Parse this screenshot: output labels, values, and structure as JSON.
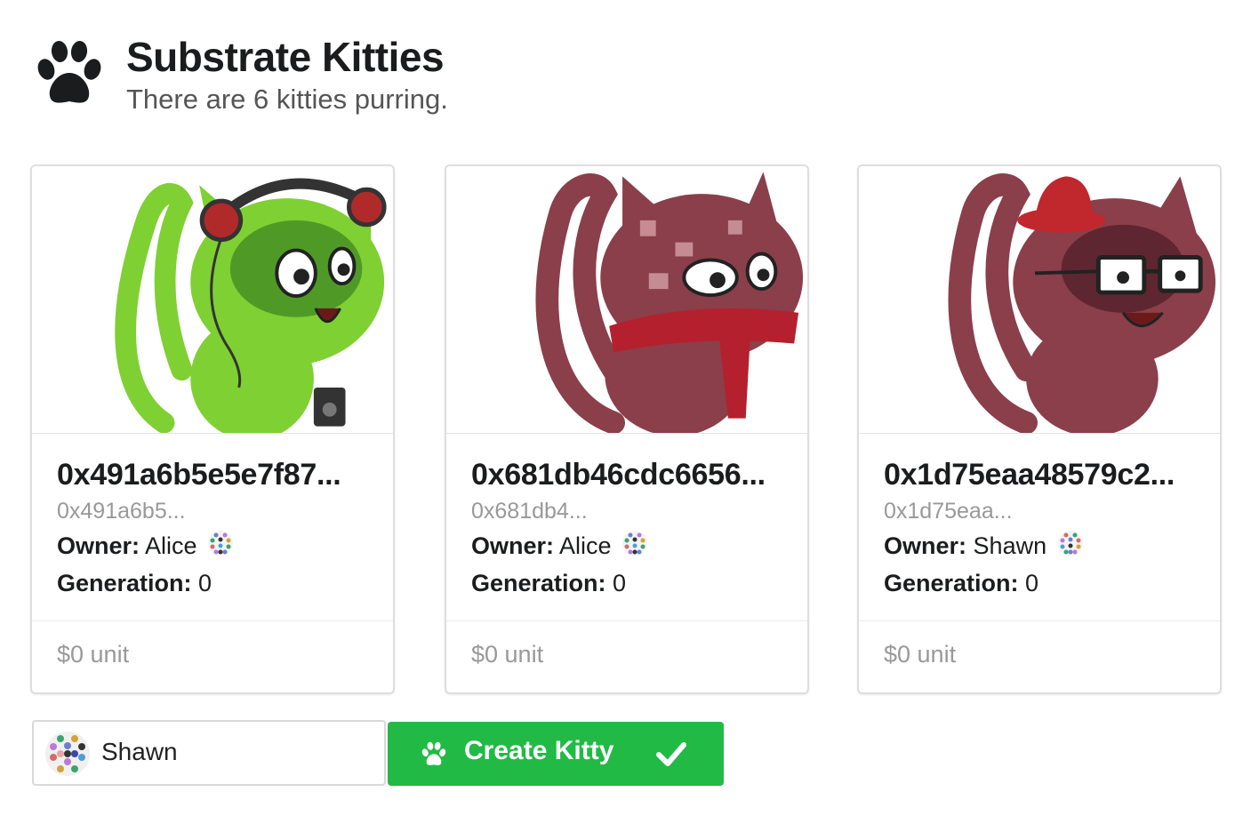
{
  "header": {
    "title": "Substrate Kitties",
    "subtitle": "There are 6 kitties purring."
  },
  "kitties": [
    {
      "id_display": "0x491a6b5e5e7f87...",
      "id_short": "0x491a6b5...",
      "owner_label": "Owner",
      "owner": "Alice",
      "generation_label": "Generation",
      "generation": "0",
      "price": "$0 unit",
      "image": "green-cat-with-headphones",
      "body_color": "#7fd032"
    },
    {
      "id_display": "0x681db46cdc6656...",
      "id_short": "0x681db4...",
      "owner_label": "Owner",
      "owner": "Alice",
      "generation_label": "Generation",
      "generation": "0",
      "price": "$0 unit",
      "image": "maroon-cat-with-scarf",
      "body_color": "#8a3f4a"
    },
    {
      "id_display": "0x1d75eaa48579c2...",
      "id_short": "0x1d75eaa...",
      "owner_label": "Owner",
      "owner": "Shawn",
      "generation_label": "Generation",
      "generation": "0",
      "price": "$0 unit",
      "image": "maroon-cat-with-hat-and-glasses",
      "body_color": "#8a3f4a"
    }
  ],
  "account": {
    "name": "Shawn",
    "avatar": "identicon"
  },
  "create_button": {
    "label": "Create Kitty",
    "icon_left": "paw-icon",
    "icon_right": "check-icon",
    "color": "#21ba45"
  }
}
